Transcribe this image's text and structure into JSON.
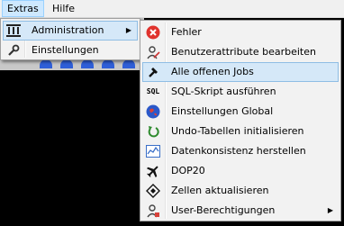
{
  "menubar": {
    "items": [
      {
        "label": "Extras"
      },
      {
        "label": "Hilfe"
      }
    ]
  },
  "extras_menu": {
    "items": [
      {
        "label": "Administration",
        "icon": "columns-icon",
        "submenu": true
      },
      {
        "label": "Einstellungen",
        "icon": "wrench-icon"
      }
    ]
  },
  "admin_menu": {
    "items": [
      {
        "label": "Fehler",
        "icon": "error-icon"
      },
      {
        "label": "Benutzerattribute bearbeiten",
        "icon": "user-edit-icon"
      },
      {
        "label": "Alle offenen Jobs",
        "icon": "hammer-icon"
      },
      {
        "label": "SQL-Skript ausführen",
        "icon": "sql-icon"
      },
      {
        "label": "Einstellungen Global",
        "icon": "globe-icon"
      },
      {
        "label": "Undo-Tabellen initialisieren",
        "icon": "undo-icon"
      },
      {
        "label": "Datenkonsistenz herstellen",
        "icon": "chart-icon"
      },
      {
        "label": "DOP20",
        "icon": "airplane-icon"
      },
      {
        "label": "Zellen aktualisieren",
        "icon": "diamond-icon"
      },
      {
        "label": "User-Berechtigungen",
        "icon": "user-permissions-icon",
        "submenu": true
      }
    ],
    "selected": "Alle offenen Jobs"
  },
  "colors": {
    "menu_bg": "#f2f2f2",
    "highlight": "#d5e8f8",
    "highlight_border": "#8fbde4",
    "menubar_active": "#cde8ff",
    "error_red": "#e0332d"
  },
  "glyphs": {
    "sql": "SQL",
    "submenu_arrow": "▶"
  }
}
